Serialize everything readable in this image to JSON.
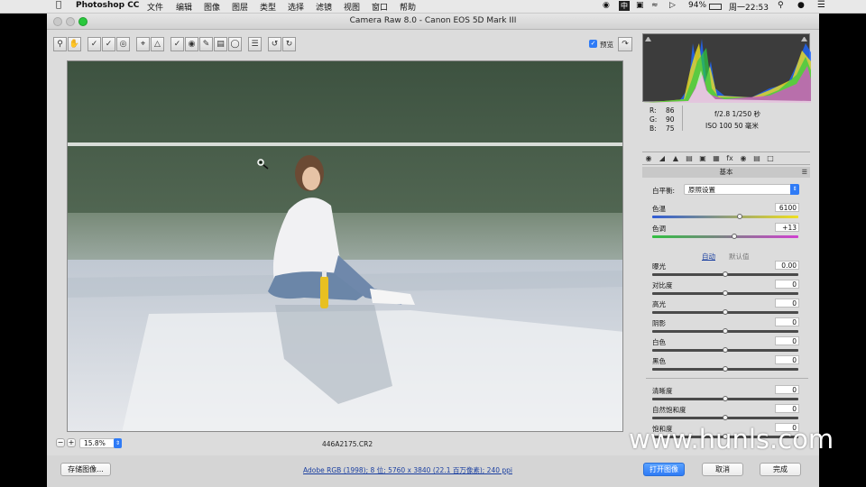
{
  "menubar": {
    "app": "Photoshop CC",
    "items": [
      "文件",
      "编辑",
      "图像",
      "图层",
      "类型",
      "选择",
      "滤镜",
      "视图",
      "窗口",
      "帮助"
    ],
    "input_method": "中",
    "battery": "94%",
    "clock": "周一22:53"
  },
  "window": {
    "title": "Camera Raw 8.0 -  Canon EOS 5D Mark III"
  },
  "toolbar": {
    "preview_label": "预览",
    "preview_checked": true
  },
  "status": {
    "zoom": "15.8%",
    "filename": "446A2175.CR2"
  },
  "bottom": {
    "save_label": "存储图像...",
    "workflow_link": "Adobe RGB (1998); 8 位; 5760 x 3840 (22.1 百万像素); 240 ppi",
    "open_label": "打开图像",
    "cancel_label": "取消",
    "done_label": "完成"
  },
  "exif": {
    "r_label": "R:",
    "r": "86",
    "g_label": "G:",
    "g": "90",
    "b_label": "B:",
    "b": "75",
    "aperture_shutter": "f/2.8   1/250 秒",
    "iso_focal": "ISO 100   50 毫米"
  },
  "panel": {
    "section": "基本",
    "wb_label": "白平衡:",
    "wb_value": "原照设置",
    "temp_label": "色温",
    "temp": "6100",
    "temp_pos": 0.6,
    "tint_label": "色调",
    "tint": "+13",
    "tint_pos": 0.56,
    "auto": "自动",
    "default": "默认值",
    "tone": [
      {
        "label": "曝光",
        "value": "0.00",
        "pos": 0.5
      },
      {
        "label": "对比度",
        "value": "0",
        "pos": 0.5
      },
      {
        "label": "高光",
        "value": "0",
        "pos": 0.5
      },
      {
        "label": "阴影",
        "value": "0",
        "pos": 0.5
      },
      {
        "label": "白色",
        "value": "0",
        "pos": 0.5
      },
      {
        "label": "黑色",
        "value": "0",
        "pos": 0.5
      }
    ],
    "presence": [
      {
        "label": "清晰度",
        "value": "0",
        "pos": 0.5
      },
      {
        "label": "自然饱和度",
        "value": "0",
        "pos": 0.5
      },
      {
        "label": "饱和度",
        "value": "0",
        "pos": 0.5
      }
    ]
  },
  "watermark": "www.hunls.com",
  "colors": {
    "accent": "#2f7bf6",
    "link": "#1a3fa0"
  }
}
